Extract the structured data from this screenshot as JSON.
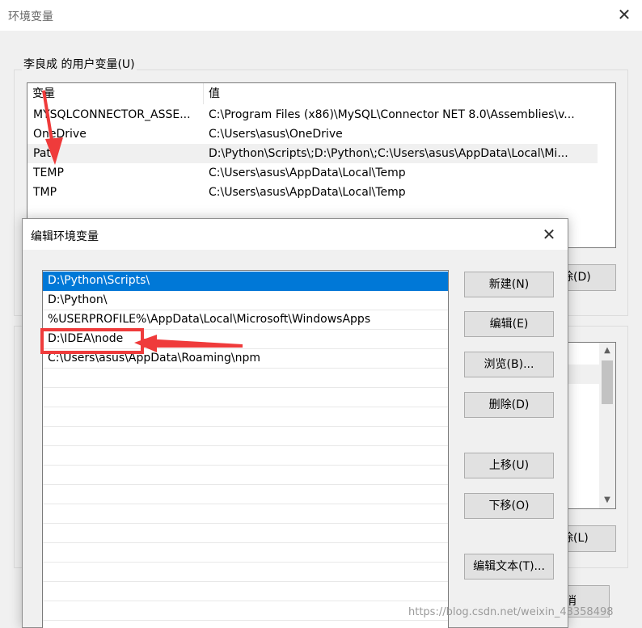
{
  "background_window": {
    "title": "环境变量",
    "close_symbol": "✕",
    "user_group_label": "李良成 的用户变量(U)",
    "user_list": {
      "headers": [
        "变量",
        "值"
      ],
      "rows": [
        {
          "name": "MYSQLCONNECTOR_ASSE...",
          "value": "C:\\Program Files (x86)\\MySQL\\Connector NET 8.0\\Assemblies\\v..."
        },
        {
          "name": "OneDrive",
          "value": "C:\\Users\\asus\\OneDrive"
        },
        {
          "name": "Path",
          "value": "D:\\Python\\Scripts\\;D:\\Python\\;C:\\Users\\asus\\AppData\\Local\\Mi..."
        },
        {
          "name": "TEMP",
          "value": "C:\\Users\\asus\\AppData\\Local\\Temp"
        },
        {
          "name": "TMP",
          "value": "C:\\Users\\asus\\AppData\\Local\\Temp"
        }
      ],
      "selected_index": 2
    },
    "buttons": {
      "delete_user": "除(D)",
      "delete_system": "除(L)",
      "cancel": "消"
    },
    "system_list_scroll": {
      "up": "▲",
      "down": "▼"
    }
  },
  "dialog": {
    "title": "编辑环境变量",
    "close_symbol": "✕",
    "path_entries": [
      "D:\\Python\\Scripts\\",
      "D:\\Python\\",
      "%USERPROFILE%\\AppData\\Local\\Microsoft\\WindowsApps",
      "D:\\IDEA\\node",
      "C:\\Users\\asus\\AppData\\Roaming\\npm"
    ],
    "selected_index": 0,
    "buttons": {
      "new": "新建(N)",
      "edit": "编辑(E)",
      "browse": "浏览(B)...",
      "delete": "删除(D)",
      "move_up": "上移(U)",
      "move_down": "下移(O)",
      "edit_text": "编辑文本(T)..."
    }
  },
  "annotation": {
    "color": "#ef3b3b",
    "highlighted_entry_index": 3
  },
  "watermark": "https://blog.csdn.net/weixin_43358498",
  "colors": {
    "selection": "#0078d7",
    "window_bg": "#f0f0f0",
    "button_bg": "#e1e1e1"
  }
}
